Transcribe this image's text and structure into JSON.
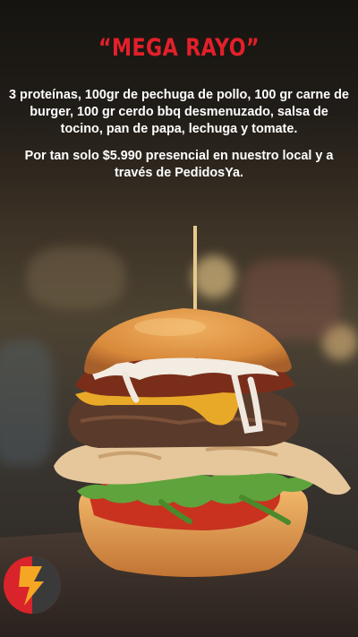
{
  "promo": {
    "title": "“MEGA RAYO”",
    "description": "3 proteínas, 100gr de pechuga de pollo, 100 gr carne de burger, 100 gr cerdo bbq desmenuzado, salsa de tocino, pan de papa, lechuga y tomate.",
    "offer": "Por tan solo $5.990 presencial en nuestro local y a través de PedidosYa."
  },
  "logo": {
    "icon": "lightning-bolt-icon"
  },
  "colors": {
    "title_red": "#e3202a",
    "text": "#ffffff",
    "logo_red": "#d8242a",
    "logo_yellow": "#f5a623"
  }
}
